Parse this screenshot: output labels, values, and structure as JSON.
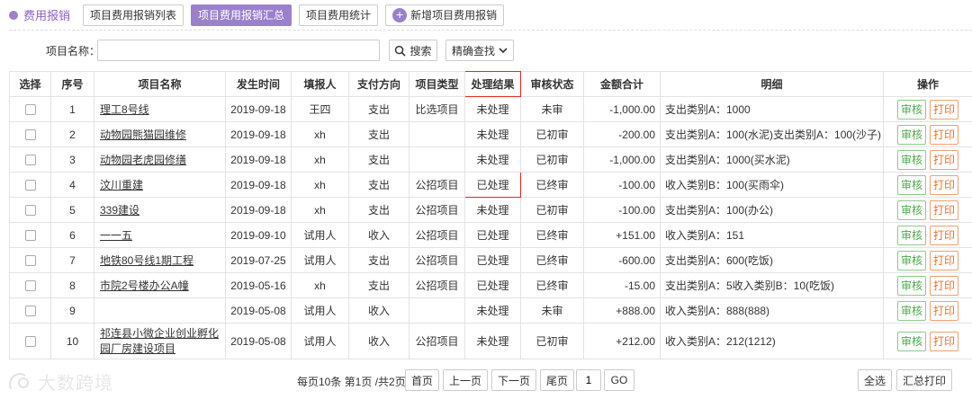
{
  "header": {
    "brand": "费用报销",
    "tabs": [
      {
        "label": "项目费用报销列表"
      },
      {
        "label": "项目费用报销汇总"
      },
      {
        "label": "项目费用统计"
      },
      {
        "label": "新增项目费用报销"
      }
    ],
    "active_tab": 1
  },
  "search": {
    "label": "项目名称：",
    "value": "",
    "placeholder": "",
    "search_label": "搜索",
    "precise_label": "精确查找"
  },
  "table": {
    "columns": [
      "选择",
      "序号",
      "项目名称",
      "发生时间",
      "填报人",
      "支付方向",
      "项目类型",
      "处理结果",
      "审核状态",
      "金额合计",
      "明细",
      "操作"
    ],
    "audit_label": "审核",
    "print_label": "打印",
    "rows": [
      {
        "no": "1",
        "name": "理工8号线",
        "date": "2019-09-18",
        "reporter": "王四",
        "direction": "支出",
        "type": "比选项目",
        "result": "未处理",
        "status": "未审",
        "amount": "-1,000.00",
        "detail": "支出类别A：1000"
      },
      {
        "no": "2",
        "name": "动物园熊猫园维修",
        "date": "2019-09-18",
        "reporter": "xh",
        "direction": "支出",
        "type": "",
        "result": "未处理",
        "status": "已初审",
        "amount": "-200.00",
        "detail": "支出类别A：100(水泥)支出类别A：100(沙子)"
      },
      {
        "no": "3",
        "name": "动物园老虎园修缮",
        "date": "2019-09-18",
        "reporter": "xh",
        "direction": "支出",
        "type": "",
        "result": "未处理",
        "status": "已初审",
        "amount": "-1,000.00",
        "detail": "支出类别A：1000(买水泥)"
      },
      {
        "no": "4",
        "name": "汶川重建",
        "date": "2019-09-18",
        "reporter": "xh",
        "direction": "支出",
        "type": "公招项目",
        "result": "已处理",
        "status": "已终审",
        "amount": "-100.00",
        "detail": "收入类别B：100(买雨伞)"
      },
      {
        "no": "5",
        "name": "339建设",
        "date": "2019-09-18",
        "reporter": "xh",
        "direction": "支出",
        "type": "公招项目",
        "result": "未处理",
        "status": "已初审",
        "amount": "-100.00",
        "detail": "支出类别A：100(办公)"
      },
      {
        "no": "6",
        "name": "一一五",
        "date": "2019-09-10",
        "reporter": "试用人",
        "direction": "收入",
        "type": "公招项目",
        "result": "已处理",
        "status": "已终审",
        "amount": "+151.00",
        "detail": "收入类别A：151"
      },
      {
        "no": "7",
        "name": "地铁80号线1期工程",
        "date": "2019-07-25",
        "reporter": "试用人",
        "direction": "支出",
        "type": "公招项目",
        "result": "已处理",
        "status": "已终审",
        "amount": "-600.00",
        "detail": "支出类别A：600(吃饭)"
      },
      {
        "no": "8",
        "name": "市院2号楼办公A幢",
        "date": "2019-05-16",
        "reporter": "xh",
        "direction": "支出",
        "type": "公招项目",
        "result": "已处理",
        "status": "已终审",
        "amount": "-15.00",
        "detail": "支出类别A：5收入类别B：10(吃饭)"
      },
      {
        "no": "9",
        "name": "",
        "date": "2019-05-08",
        "reporter": "试用人",
        "direction": "收入",
        "type": "",
        "result": "未处理",
        "status": "未审",
        "amount": "+888.00",
        "detail": "收入类别A：888(888)"
      },
      {
        "no": "10",
        "name": "祁连县小微企业创业孵化园厂房建设项目",
        "date": "2019-05-08",
        "reporter": "试用人",
        "direction": "收入",
        "type": "公招项目",
        "result": "未处理",
        "status": "已初审",
        "amount": "+212.00",
        "detail": "收入类别A：212(1212)"
      }
    ]
  },
  "pagination": {
    "info": "每页10条 第1页 /共2页",
    "first": "首页",
    "prev": "上一页",
    "next": "下一页",
    "last": "尾页",
    "page_value": "1",
    "go": "GO",
    "select_all": "全选",
    "print_summary": "汇总打印"
  },
  "watermark": "大数跨境",
  "colors": {
    "accent": "#9b80cc",
    "red": "#e8261d",
    "green": "#2aa02a",
    "print": "#e8702a"
  }
}
